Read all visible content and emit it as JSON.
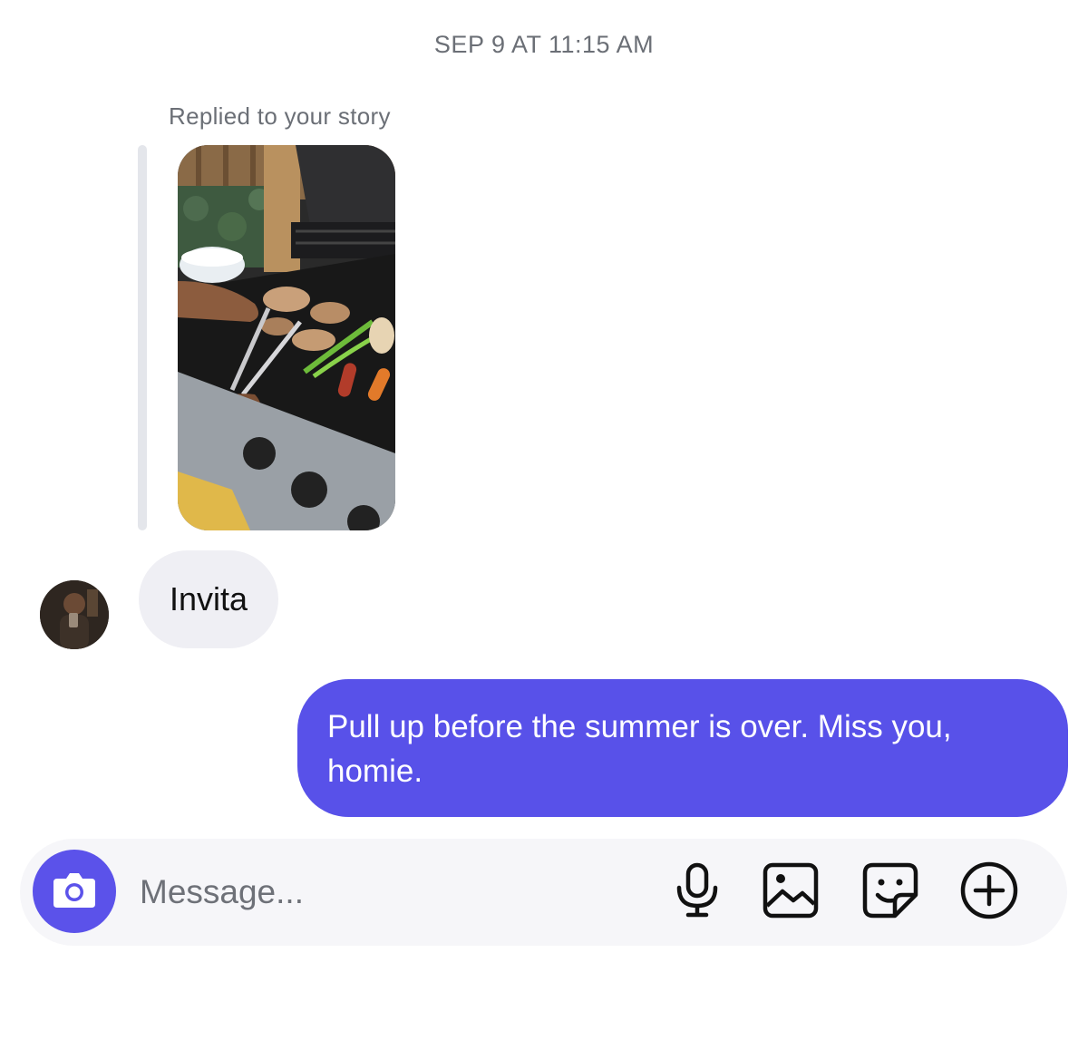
{
  "thread": {
    "timestamp": "SEP 9 AT 11:15 AM",
    "reply_note": "Replied to your story"
  },
  "messages": [
    {
      "direction": "incoming",
      "text": "Invita"
    },
    {
      "direction": "outgoing",
      "text": "Pull up before the summer is over. Miss you, homie."
    }
  ],
  "composer": {
    "placeholder": "Message...",
    "icons": [
      "camera-icon",
      "microphone-icon",
      "gallery-icon",
      "sticker-icon",
      "plus-icon"
    ]
  },
  "colors": {
    "outgoing_bubble": "#5851e9",
    "incoming_bubble": "#efeff4",
    "camera_button": "#5b52ea"
  }
}
